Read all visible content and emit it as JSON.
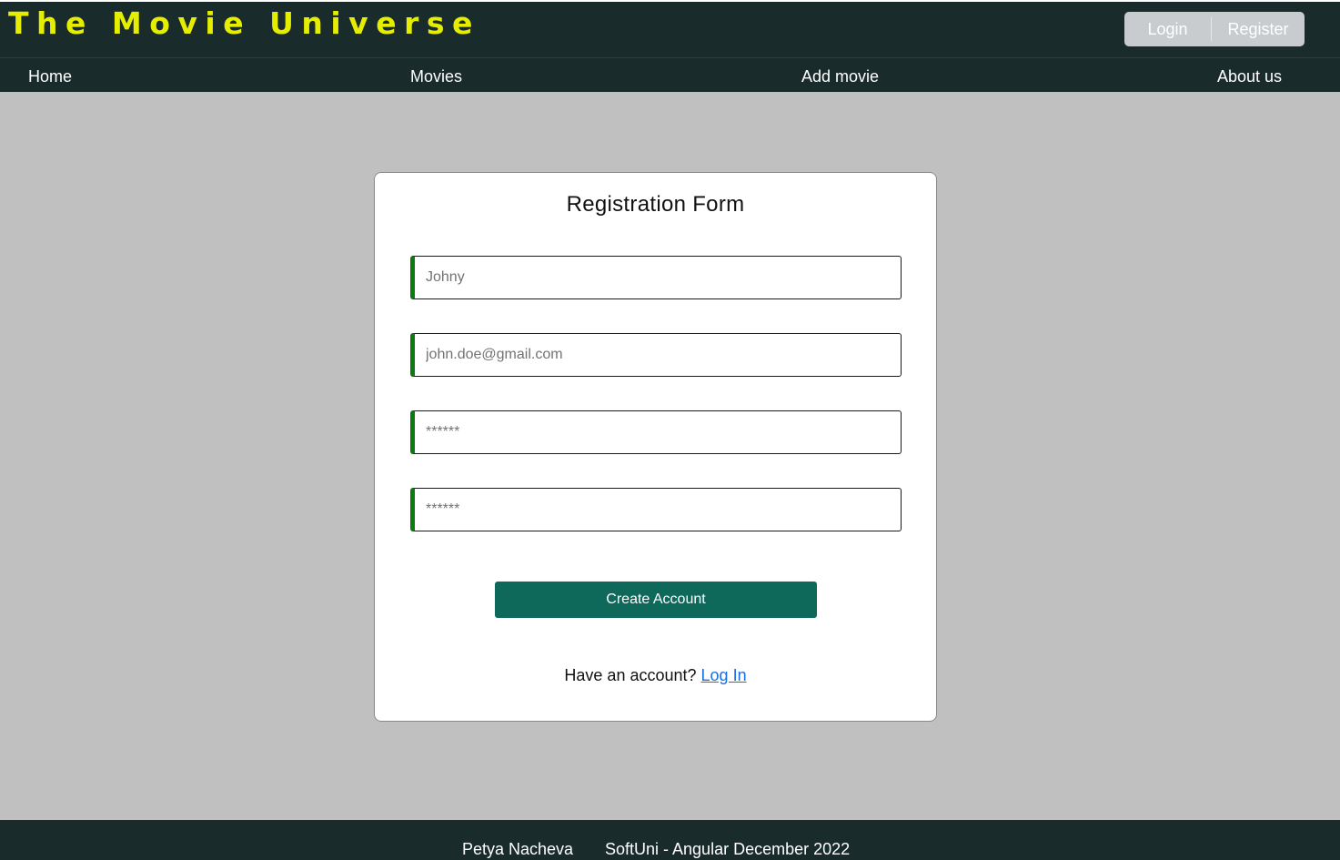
{
  "header": {
    "brand": "The Movie Universe",
    "login_label": "Login",
    "register_label": "Register"
  },
  "nav": {
    "home": "Home",
    "movies": "Movies",
    "add_movie": "Add movie",
    "about_us": "About us"
  },
  "form": {
    "title": "Registration Form",
    "username_placeholder": "Johny",
    "email_placeholder": "john.doe@gmail.com",
    "password_placeholder": "******",
    "repass_placeholder": "******",
    "submit_label": "Create Account",
    "have_account_text": "Have an account?",
    "login_link_label": "Log In"
  },
  "footer": {
    "author": "Petya Nacheva",
    "course": "SoftUni - Angular December 2022"
  },
  "colors": {
    "header_bg": "#1a2b2c",
    "brand": "#e6ee00",
    "page_bg": "#c0c0c0",
    "field_accent": "#0c7a10",
    "submit_bg": "#0f695b",
    "link": "#1a6fe0"
  }
}
